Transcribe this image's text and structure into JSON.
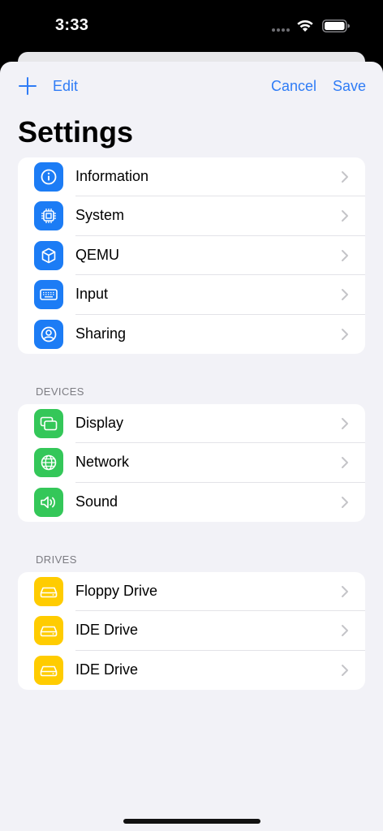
{
  "status": {
    "time": "3:33"
  },
  "nav": {
    "edit_label": "Edit",
    "cancel_label": "Cancel",
    "save_label": "Save"
  },
  "page": {
    "title": "Settings"
  },
  "general": {
    "items": [
      {
        "label": "Information",
        "icon": "info-icon"
      },
      {
        "label": "System",
        "icon": "chip-icon"
      },
      {
        "label": "QEMU",
        "icon": "cube-icon"
      },
      {
        "label": "Input",
        "icon": "keyboard-icon"
      },
      {
        "label": "Sharing",
        "icon": "person-circle-icon"
      }
    ]
  },
  "devices": {
    "header": "DEVICES",
    "items": [
      {
        "label": "Display",
        "icon": "display-icon"
      },
      {
        "label": "Network",
        "icon": "globe-icon"
      },
      {
        "label": "Sound",
        "icon": "speaker-icon"
      }
    ]
  },
  "drives": {
    "header": "DRIVES",
    "items": [
      {
        "label": "Floppy Drive",
        "icon": "drive-icon"
      },
      {
        "label": "IDE Drive",
        "icon": "drive-icon"
      },
      {
        "label": "IDE Drive",
        "icon": "drive-icon"
      }
    ]
  },
  "colors": {
    "accent": "#2f7cf6",
    "blue_icon": "#1c7cf5",
    "green_icon": "#34c759",
    "yellow_icon": "#ffcc00"
  }
}
